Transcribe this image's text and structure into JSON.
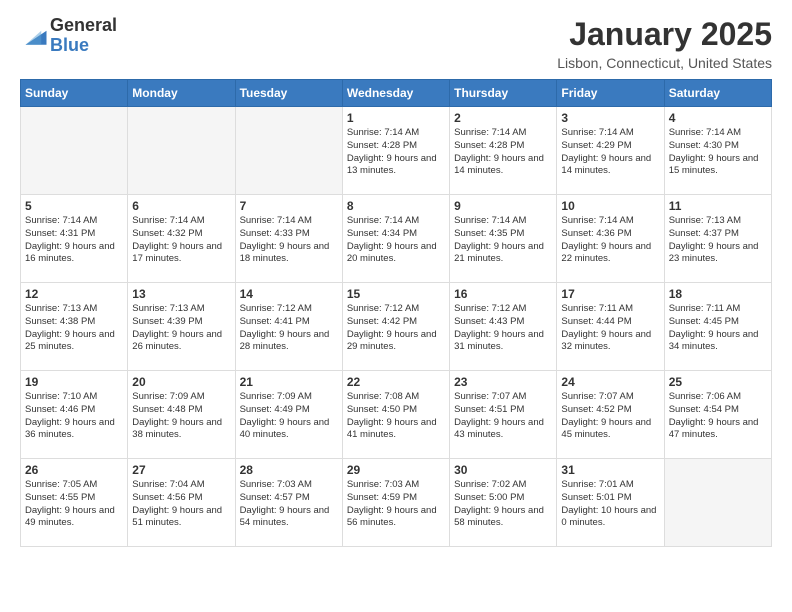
{
  "logo": {
    "general": "General",
    "blue": "Blue"
  },
  "header": {
    "month": "January 2025",
    "location": "Lisbon, Connecticut, United States"
  },
  "weekdays": [
    "Sunday",
    "Monday",
    "Tuesday",
    "Wednesday",
    "Thursday",
    "Friday",
    "Saturday"
  ],
  "weeks": [
    [
      {
        "day": "",
        "empty": true
      },
      {
        "day": "",
        "empty": true
      },
      {
        "day": "",
        "empty": true
      },
      {
        "day": "1",
        "sunrise": "7:14 AM",
        "sunset": "4:28 PM",
        "daylight": "9 hours and 13 minutes."
      },
      {
        "day": "2",
        "sunrise": "7:14 AM",
        "sunset": "4:28 PM",
        "daylight": "9 hours and 14 minutes."
      },
      {
        "day": "3",
        "sunrise": "7:14 AM",
        "sunset": "4:29 PM",
        "daylight": "9 hours and 14 minutes."
      },
      {
        "day": "4",
        "sunrise": "7:14 AM",
        "sunset": "4:30 PM",
        "daylight": "9 hours and 15 minutes."
      }
    ],
    [
      {
        "day": "5",
        "sunrise": "7:14 AM",
        "sunset": "4:31 PM",
        "daylight": "9 hours and 16 minutes."
      },
      {
        "day": "6",
        "sunrise": "7:14 AM",
        "sunset": "4:32 PM",
        "daylight": "9 hours and 17 minutes."
      },
      {
        "day": "7",
        "sunrise": "7:14 AM",
        "sunset": "4:33 PM",
        "daylight": "9 hours and 18 minutes."
      },
      {
        "day": "8",
        "sunrise": "7:14 AM",
        "sunset": "4:34 PM",
        "daylight": "9 hours and 20 minutes."
      },
      {
        "day": "9",
        "sunrise": "7:14 AM",
        "sunset": "4:35 PM",
        "daylight": "9 hours and 21 minutes."
      },
      {
        "day": "10",
        "sunrise": "7:14 AM",
        "sunset": "4:36 PM",
        "daylight": "9 hours and 22 minutes."
      },
      {
        "day": "11",
        "sunrise": "7:13 AM",
        "sunset": "4:37 PM",
        "daylight": "9 hours and 23 minutes."
      }
    ],
    [
      {
        "day": "12",
        "sunrise": "7:13 AM",
        "sunset": "4:38 PM",
        "daylight": "9 hours and 25 minutes."
      },
      {
        "day": "13",
        "sunrise": "7:13 AM",
        "sunset": "4:39 PM",
        "daylight": "9 hours and 26 minutes."
      },
      {
        "day": "14",
        "sunrise": "7:12 AM",
        "sunset": "4:41 PM",
        "daylight": "9 hours and 28 minutes."
      },
      {
        "day": "15",
        "sunrise": "7:12 AM",
        "sunset": "4:42 PM",
        "daylight": "9 hours and 29 minutes."
      },
      {
        "day": "16",
        "sunrise": "7:12 AM",
        "sunset": "4:43 PM",
        "daylight": "9 hours and 31 minutes."
      },
      {
        "day": "17",
        "sunrise": "7:11 AM",
        "sunset": "4:44 PM",
        "daylight": "9 hours and 32 minutes."
      },
      {
        "day": "18",
        "sunrise": "7:11 AM",
        "sunset": "4:45 PM",
        "daylight": "9 hours and 34 minutes."
      }
    ],
    [
      {
        "day": "19",
        "sunrise": "7:10 AM",
        "sunset": "4:46 PM",
        "daylight": "9 hours and 36 minutes."
      },
      {
        "day": "20",
        "sunrise": "7:09 AM",
        "sunset": "4:48 PM",
        "daylight": "9 hours and 38 minutes."
      },
      {
        "day": "21",
        "sunrise": "7:09 AM",
        "sunset": "4:49 PM",
        "daylight": "9 hours and 40 minutes."
      },
      {
        "day": "22",
        "sunrise": "7:08 AM",
        "sunset": "4:50 PM",
        "daylight": "9 hours and 41 minutes."
      },
      {
        "day": "23",
        "sunrise": "7:07 AM",
        "sunset": "4:51 PM",
        "daylight": "9 hours and 43 minutes."
      },
      {
        "day": "24",
        "sunrise": "7:07 AM",
        "sunset": "4:52 PM",
        "daylight": "9 hours and 45 minutes."
      },
      {
        "day": "25",
        "sunrise": "7:06 AM",
        "sunset": "4:54 PM",
        "daylight": "9 hours and 47 minutes."
      }
    ],
    [
      {
        "day": "26",
        "sunrise": "7:05 AM",
        "sunset": "4:55 PM",
        "daylight": "9 hours and 49 minutes."
      },
      {
        "day": "27",
        "sunrise": "7:04 AM",
        "sunset": "4:56 PM",
        "daylight": "9 hours and 51 minutes."
      },
      {
        "day": "28",
        "sunrise": "7:03 AM",
        "sunset": "4:57 PM",
        "daylight": "9 hours and 54 minutes."
      },
      {
        "day": "29",
        "sunrise": "7:03 AM",
        "sunset": "4:59 PM",
        "daylight": "9 hours and 56 minutes."
      },
      {
        "day": "30",
        "sunrise": "7:02 AM",
        "sunset": "5:00 PM",
        "daylight": "9 hours and 58 minutes."
      },
      {
        "day": "31",
        "sunrise": "7:01 AM",
        "sunset": "5:01 PM",
        "daylight": "10 hours and 0 minutes."
      },
      {
        "day": "",
        "empty": true
      }
    ]
  ]
}
